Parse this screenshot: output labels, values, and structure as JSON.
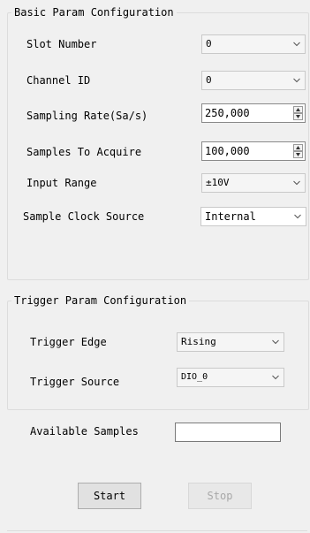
{
  "basic": {
    "title": "Basic Param Configuration",
    "slot_label": "Slot Number",
    "slot_value": "0",
    "channel_label": "Channel ID",
    "channel_value": "0",
    "rate_label": "Sampling Rate(Sa/s)",
    "rate_value": "250,000",
    "samples_label": "Samples To Acquire",
    "samples_value": "100,000",
    "range_label": "Input Range",
    "range_value": "±10V",
    "clock_label": "Sample Clock Source",
    "clock_value": "Internal"
  },
  "trigger": {
    "title": "Trigger Param Configuration",
    "edge_label": "Trigger Edge",
    "edge_value": "Rising",
    "source_label": "Trigger Source",
    "source_value": "DIO_0"
  },
  "footer": {
    "available_label": "Available Samples",
    "available_value": "",
    "start_label": "Start",
    "stop_label": "Stop"
  },
  "icons": {
    "dropdown": "chevron-down-icon",
    "spin_up": "triangle-up-icon",
    "spin_down": "triangle-down-icon"
  }
}
